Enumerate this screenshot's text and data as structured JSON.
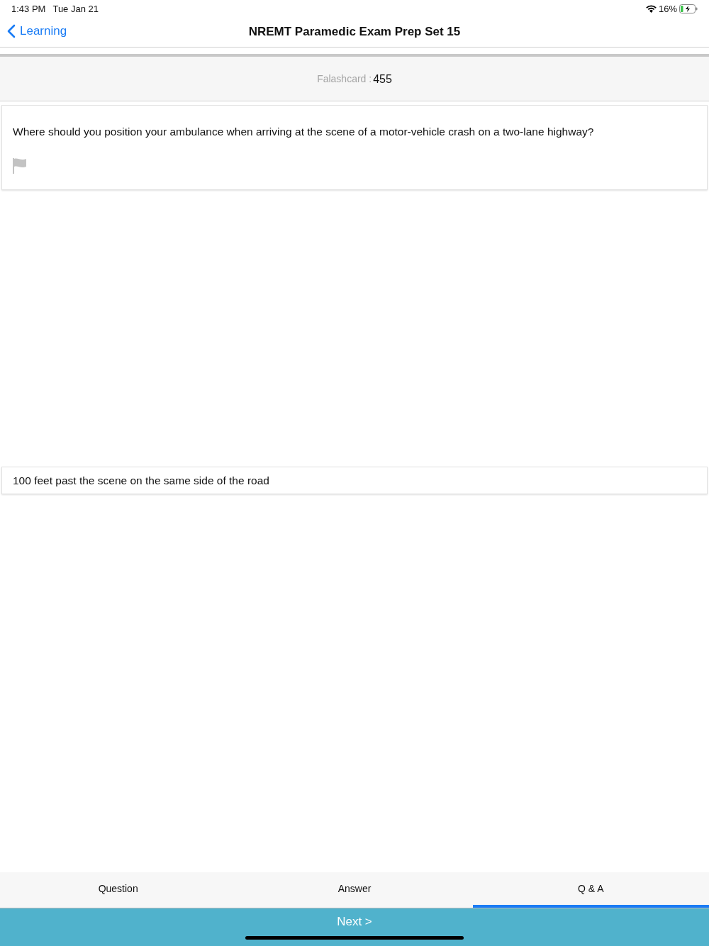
{
  "status_bar": {
    "time": "1:43 PM",
    "date": "Tue Jan 21",
    "battery": "16%"
  },
  "nav": {
    "back": "Learning",
    "title": "NREMT Paramedic Exam Prep Set 15"
  },
  "header": {
    "label": "Falashcard :",
    "number": "455"
  },
  "question": {
    "text": "Where should you position your ambulance when arriving at the scene of a motor-vehicle crash on a two-lane highway?",
    "flagged": false
  },
  "answer": {
    "text": "100 feet past the scene on the same side of the road"
  },
  "tabs": [
    {
      "label": "Question",
      "selected": false
    },
    {
      "label": "Answer",
      "selected": false
    },
    {
      "label": "Q & A",
      "selected": true
    }
  ],
  "next_button": "Next >"
}
